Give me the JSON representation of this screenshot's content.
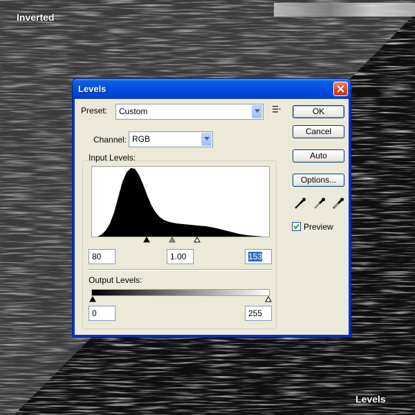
{
  "labels": {
    "top_left": "Inverted",
    "bottom_right": "Levels"
  },
  "dialog": {
    "title": "Levels",
    "preset": {
      "label": "Preset:",
      "value": "Custom"
    },
    "channel": {
      "label": "Channel:",
      "value": "RGB"
    },
    "input_levels": {
      "label": "Input Levels:",
      "black": "80",
      "gamma": "1.00",
      "white": "153"
    },
    "output_levels": {
      "label": "Output Levels:",
      "black": "0",
      "white": "255"
    },
    "buttons": {
      "ok": "OK",
      "cancel": "Cancel",
      "auto": "Auto",
      "options": "Options..."
    },
    "preview": {
      "label": "Preview",
      "checked": true
    },
    "icons": [
      "close-icon",
      "dropdown-arrow-icon",
      "preset-menu-icon",
      "black-point-eyedropper-icon",
      "gray-point-eyedropper-icon",
      "white-point-eyedropper-icon",
      "checkmark-icon"
    ],
    "colors": {
      "title_bar": "#0a5fe8",
      "dialog_bg": "#ece9d8",
      "close_button": "#d4431e",
      "selection": "#316ac5"
    }
  }
}
